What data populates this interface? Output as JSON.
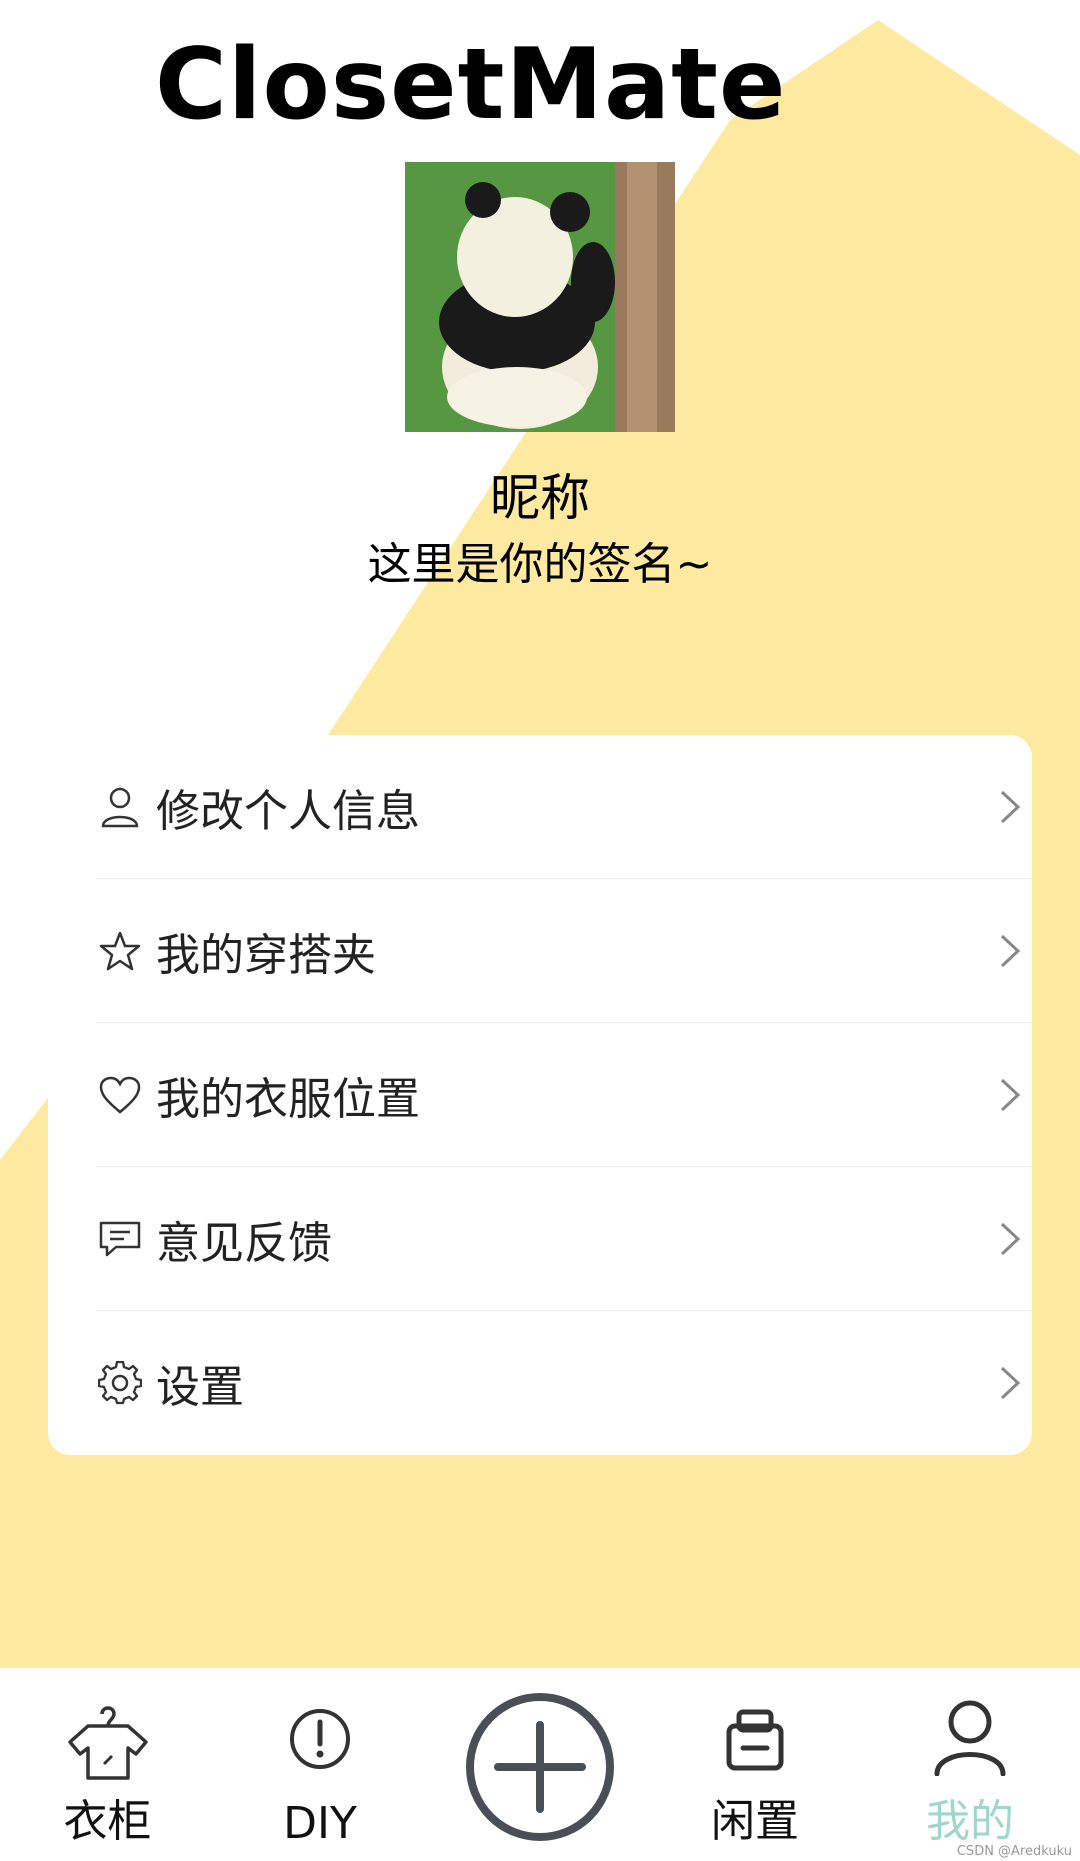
{
  "app": {
    "title": "ClosetMate"
  },
  "profile": {
    "avatar_icon": "panda-photo",
    "nickname": "昵称",
    "signature": "这里是你的签名~"
  },
  "menu": {
    "items": [
      {
        "label": "修改个人信息",
        "icon": "user-icon"
      },
      {
        "label": "我的穿搭夹",
        "icon": "star-icon"
      },
      {
        "label": "我的衣服位置",
        "icon": "heart-icon"
      },
      {
        "label": "意见反馈",
        "icon": "feedback-icon"
      },
      {
        "label": "设置",
        "icon": "gear-icon"
      }
    ]
  },
  "tabbar": {
    "tabs": [
      {
        "label": "衣柜",
        "icon": "hanger-shirt-icon",
        "active": false
      },
      {
        "label": "DIY",
        "icon": "alert-circle-icon",
        "active": false
      },
      {
        "label": "",
        "icon": "plus-circle-icon",
        "active": false
      },
      {
        "label": "闲置",
        "icon": "box-icon",
        "active": false
      },
      {
        "label": "我的",
        "icon": "user-icon",
        "active": true
      }
    ]
  },
  "colors": {
    "background_shape": "#fde9a0",
    "active_tab": "#9fd6cf"
  },
  "watermark": "CSDN @Aredkuku"
}
